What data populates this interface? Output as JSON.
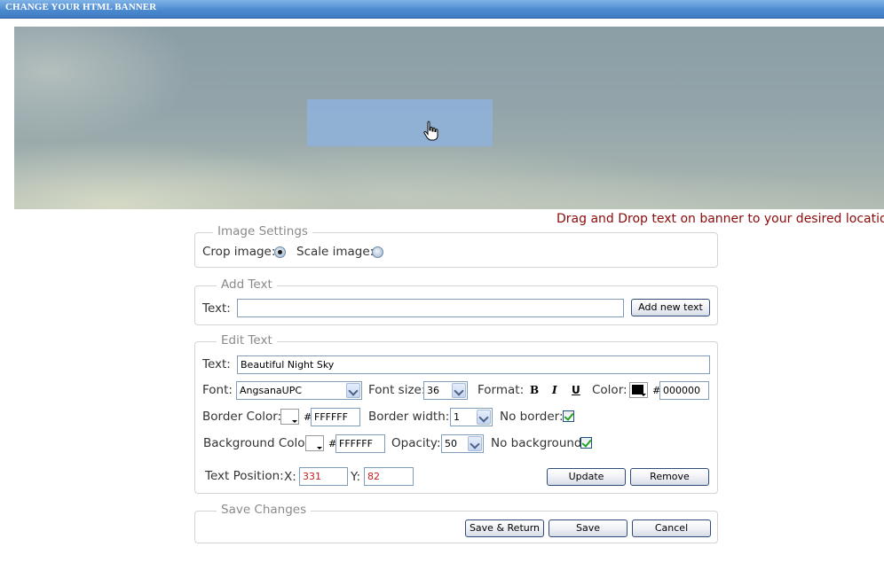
{
  "window": {
    "title": "CHANGE YOUR HTML BANNER"
  },
  "banner": {
    "hint": "Drag and Drop text on banner to your desired location",
    "text_box_color": "#8fb1d8"
  },
  "image_settings": {
    "legend": "Image Settings",
    "crop_label": "Crop image:",
    "scale_label": "Scale image:",
    "selected": "crop"
  },
  "add_text": {
    "legend": "Add Text",
    "text_label": "Text:",
    "text_value": "",
    "add_button": "Add new text"
  },
  "edit_text": {
    "legend": "Edit Text",
    "text_label": "Text:",
    "text_value": "Beautiful Night Sky",
    "font_label": "Font:",
    "font_value": "AngsanaUPC",
    "font_size_label": "Font size:",
    "font_size_value": "36",
    "format_label": "Format:",
    "format_bold": "B",
    "format_italic": "I",
    "format_underline": "U",
    "color_label": "Color:",
    "color_hex": "000000",
    "border_color_label": "Border Color:",
    "border_color_hex": "FFFFFF",
    "border_width_label": "Border width:",
    "border_width_value": "1",
    "no_border_label": "No border:",
    "no_border_checked": true,
    "bg_color_label": "Background Color:",
    "bg_color_hex": "FFFFFF",
    "opacity_label": "Opacity:",
    "opacity_value": "50",
    "no_bg_label": "No background:",
    "no_bg_checked": true,
    "position_label": "Text Position:",
    "x_label": "X:",
    "x_value": "331",
    "y_label": "Y:",
    "y_value": "82",
    "update_button": "Update",
    "remove_button": "Remove",
    "hash": "#"
  },
  "save_changes": {
    "legend": "Save Changes",
    "save_return_button": "Save & Return",
    "save_button": "Save",
    "cancel_button": "Cancel"
  },
  "colors": {
    "titlebar": "#4d8bd0",
    "hint_text": "#8b0a0a",
    "button_border": "#2f4c7a",
    "check_green": "#21a121"
  }
}
